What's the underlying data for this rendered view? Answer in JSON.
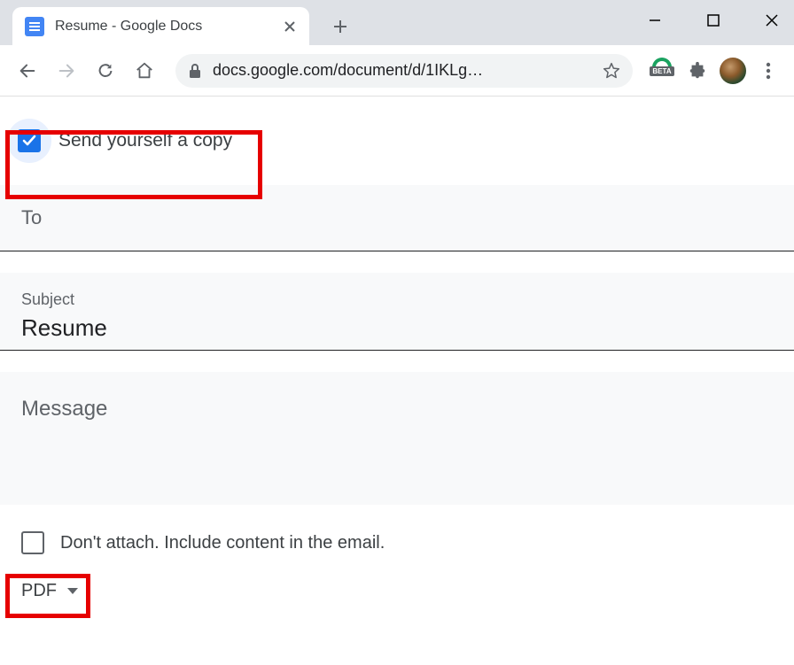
{
  "browser": {
    "tab_title": "Resume - Google Docs",
    "url_display": "docs.google.com/document/d/1IKLg…",
    "beta_label": "BETA"
  },
  "dialog": {
    "send_copy": {
      "label": "Send yourself a copy",
      "checked": true
    },
    "to": {
      "label": "To",
      "value": ""
    },
    "subject": {
      "label": "Subject",
      "value": "Resume"
    },
    "message": {
      "label": "Message",
      "value": ""
    },
    "dont_attach": {
      "label": "Don't attach. Include content in the email.",
      "checked": false
    },
    "format": {
      "selected": "PDF"
    }
  }
}
